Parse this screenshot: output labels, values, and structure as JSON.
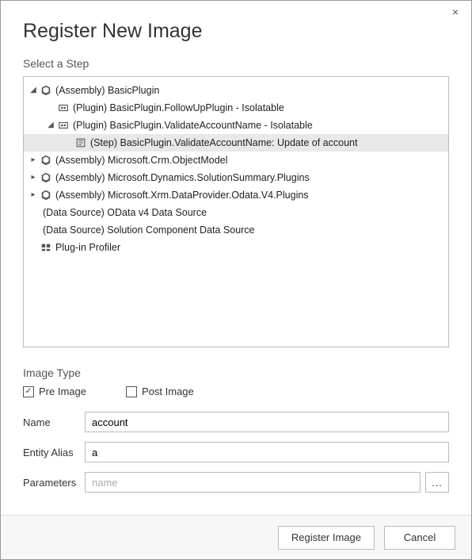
{
  "dialog": {
    "title": "Register New Image",
    "close_icon_label": "×"
  },
  "step_section": {
    "label": "Select a Step",
    "tree": [
      {
        "indent": 0,
        "expander": "open",
        "icon": "assembly",
        "label": "(Assembly) BasicPlugin",
        "selected": false
      },
      {
        "indent": 1,
        "expander": "none",
        "icon": "plugin",
        "label": "(Plugin) BasicPlugin.FollowUpPlugin - Isolatable",
        "selected": false
      },
      {
        "indent": 1,
        "expander": "open",
        "icon": "plugin",
        "label": "(Plugin) BasicPlugin.ValidateAccountName - Isolatable",
        "selected": false
      },
      {
        "indent": 2,
        "expander": "none",
        "icon": "step",
        "label": "(Step) BasicPlugin.ValidateAccountName: Update of account",
        "selected": true
      },
      {
        "indent": 0,
        "expander": "closed",
        "icon": "assembly",
        "label": "(Assembly) Microsoft.Crm.ObjectModel",
        "selected": false
      },
      {
        "indent": 0,
        "expander": "closed",
        "icon": "assembly",
        "label": "(Assembly) Microsoft.Dynamics.SolutionSummary.Plugins",
        "selected": false
      },
      {
        "indent": 0,
        "expander": "closed",
        "icon": "assembly",
        "label": "(Assembly) Microsoft.Xrm.DataProvider.Odata.V4.Plugins",
        "selected": false
      },
      {
        "indent": 0,
        "expander": "none",
        "icon": "none",
        "label": "(Data Source) OData v4 Data Source",
        "selected": false
      },
      {
        "indent": 0,
        "expander": "none",
        "icon": "none",
        "label": "(Data Source) Solution Component Data Source",
        "selected": false
      },
      {
        "indent": 0,
        "expander": "none",
        "icon": "profiler",
        "label": "Plug-in Profiler",
        "selected": false
      }
    ]
  },
  "image_type": {
    "label": "Image Type",
    "pre_image": {
      "label": "Pre Image",
      "checked": true
    },
    "post_image": {
      "label": "Post Image",
      "checked": false
    }
  },
  "fields": {
    "name": {
      "label": "Name",
      "value": "account",
      "placeholder": ""
    },
    "entity_alias": {
      "label": "Entity Alias",
      "value": "a",
      "placeholder": ""
    },
    "parameters": {
      "label": "Parameters",
      "value": "",
      "placeholder": "name",
      "button_label": "..."
    }
  },
  "footer": {
    "register": "Register Image",
    "cancel": "Cancel"
  }
}
